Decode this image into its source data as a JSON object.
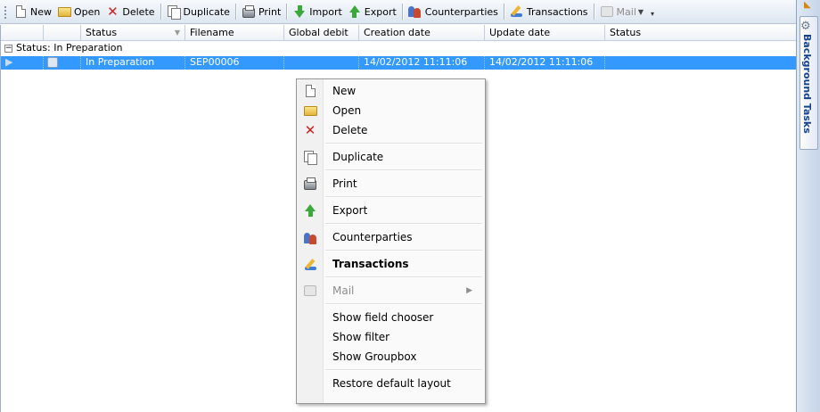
{
  "toolbar": {
    "items": [
      {
        "label": "New",
        "icon": "new-document-icon"
      },
      {
        "label": "Open",
        "icon": "folder-open-icon"
      },
      {
        "label": "Delete",
        "icon": "delete-x-icon"
      },
      {
        "label": "Duplicate",
        "icon": "duplicate-icon"
      },
      {
        "label": "Print",
        "icon": "printer-icon"
      },
      {
        "label": "Import",
        "icon": "import-arrow-icon"
      },
      {
        "label": "Export",
        "icon": "export-arrow-icon"
      },
      {
        "label": "Counterparties",
        "icon": "counterparties-icon"
      },
      {
        "label": "Transactions",
        "icon": "transactions-icon"
      },
      {
        "label": "Mail",
        "icon": "mail-icon",
        "disabled": true
      }
    ]
  },
  "grid": {
    "columns": [
      "Status",
      "Filename",
      "Global debit",
      "Creation date",
      "Update date",
      "Status"
    ],
    "group": {
      "label": "Status: In Preparation"
    },
    "rows": [
      {
        "status": "In Preparation",
        "filename": "SEP00006",
        "global_debit": "",
        "creation_date": "14/02/2012 11:11:06",
        "update_date": "14/02/2012 11:11:06",
        "status2": ""
      }
    ]
  },
  "side_panel": {
    "tab_label": "Background Tasks"
  },
  "context_menu": {
    "items": [
      {
        "label": "New",
        "icon": "new-document-icon"
      },
      {
        "label": "Open",
        "icon": "folder-open-icon"
      },
      {
        "label": "Delete",
        "icon": "delete-x-icon"
      },
      {
        "label": "Duplicate",
        "icon": "duplicate-icon"
      },
      {
        "label": "Print",
        "icon": "printer-icon"
      },
      {
        "label": "Export",
        "icon": "export-arrow-icon"
      },
      {
        "label": "Counterparties",
        "icon": "counterparties-icon"
      },
      {
        "label": "Transactions",
        "icon": "transactions-icon"
      },
      {
        "label": "Mail",
        "icon": "mail-icon"
      },
      {
        "label": "Show field chooser"
      },
      {
        "label": "Show filter"
      },
      {
        "label": "Show Groupbox"
      },
      {
        "label": "Restore default layout"
      }
    ]
  },
  "colors": {
    "selection": "#3399ff",
    "toolbar_bg": "#dde6f1",
    "delete_red": "#d21f1f",
    "arrow_green": "#3aa83a"
  }
}
